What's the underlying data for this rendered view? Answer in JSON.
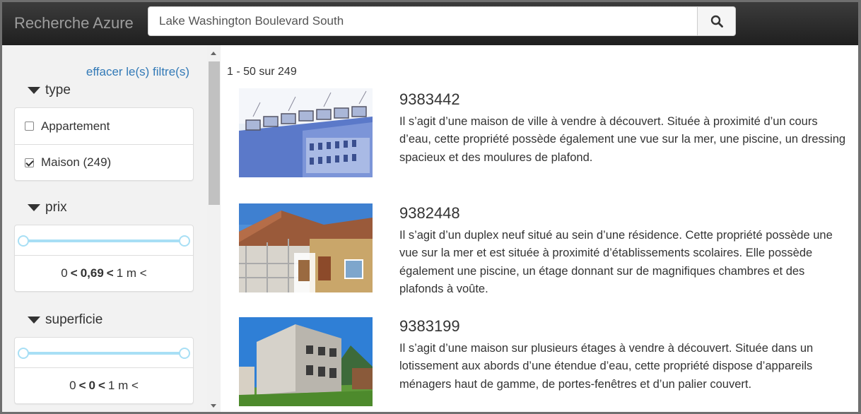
{
  "header": {
    "brand": "Recherche Azure",
    "search_value": "Lake Washington Boulevard South",
    "search_icon": "search-icon"
  },
  "sidebar": {
    "clear_filters": "effacer le(s) filtre(s)",
    "type_facet": {
      "title": "type",
      "options": [
        {
          "label": "Appartement",
          "checked": false
        },
        {
          "label": "Maison (249)",
          "checked": true
        }
      ]
    },
    "price_facet": {
      "title": "prix",
      "range_low": "0",
      "range_sep1": "<",
      "range_value": "0,69",
      "range_sep2": "<",
      "range_high": "1 m <"
    },
    "area_facet": {
      "title": "superficie",
      "range_low": "0",
      "range_sep1": "<",
      "range_value": "0",
      "range_sep2": "<",
      "range_high": "1 m <"
    }
  },
  "results": {
    "count_text": "1 - 50 sur 249",
    "items": [
      {
        "id": "9383442",
        "description": "Il s’agit d’une maison de ville à vendre à découvert. Située à proximité d’un cours d’eau, cette propriété possède également une vue sur la mer, une piscine, un dressing spacieux et des moulures de plafond."
      },
      {
        "id": "9382448",
        "description": "Il s’agit d’un duplex neuf situé au sein d’une résidence. Cette propriété possède une vue sur la mer et est située à proximité d’établissements scolaires. Elle possède également une piscine, un étage donnant sur de magnifiques chambres et des plafonds à voûte."
      },
      {
        "id": "9383199",
        "description": "Il s’agit d’une maison sur plusieurs étages à vendre à découvert. Située dans un lotissement aux abords d’une étendue d’eau, cette propriété dispose d’appareils ménagers haut de gamme, de portes-fenêtres et d’un palier couvert."
      }
    ]
  },
  "colors": {
    "navbar": "#222222",
    "brand_text": "#9d9d9d",
    "link": "#337ab7",
    "slider": "#a8dff5",
    "sidebar_bg": "#f2f2f2"
  }
}
